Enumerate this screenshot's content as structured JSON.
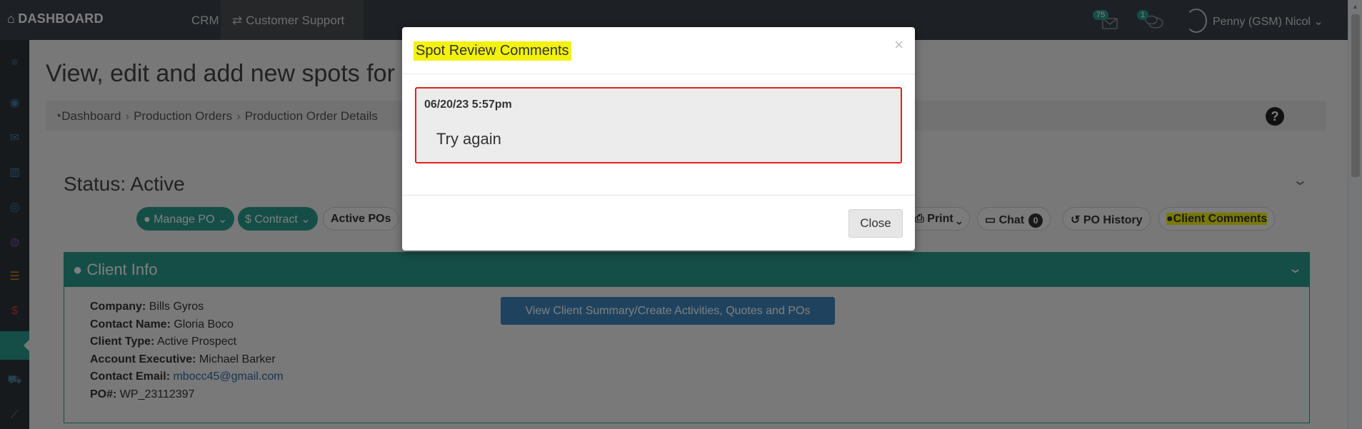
{
  "topbar": {
    "brand": "DASHBOARD",
    "crm": "CRM",
    "customer_support": "Customer Support",
    "mail_count": "75",
    "chat_count": "1",
    "user_name": "Penny (GSM) Nicol"
  },
  "page": {
    "title": "View, edit and add new spots for this",
    "breadcrumb": [
      "Dashboard",
      "Production Orders",
      "Production Order Details"
    ],
    "help": "?"
  },
  "status": "Status: Active",
  "toolbar": {
    "manage_po": "Manage PO",
    "contract": "Contract",
    "active_pos": "Active POs",
    "print": "Print",
    "chat": "Chat",
    "chat_count": "0",
    "po_history": "PO History",
    "client_comments": "Client Comments"
  },
  "client_info": {
    "header": "Client Info",
    "button": "View Client Summary/Create Activities, Quotes and POs",
    "fields": [
      {
        "label": "Company:",
        "value": "Bills Gyros"
      },
      {
        "label": "Contact Name:",
        "value": "Gloria Boco"
      },
      {
        "label": "Client Type:",
        "value": "Active Prospect"
      },
      {
        "label": "Account Executive:",
        "value": "Michael Barker"
      },
      {
        "label": "Contact Email:",
        "value": "mbocc45@gmail.com"
      },
      {
        "label": "PO#:",
        "value": "WP_23112397"
      }
    ]
  },
  "modal": {
    "title": "Spot Review Comments",
    "close_x": "×",
    "comment_date": "06/20/23 5:57pm",
    "comment_text": "Try again",
    "close_button": "Close"
  },
  "colors": {
    "accent": "#2a9d8f",
    "navbar": "#3a4149",
    "highlight": "#f3f20f",
    "comment_border": "#e02020",
    "link": "#2a6aa8"
  }
}
